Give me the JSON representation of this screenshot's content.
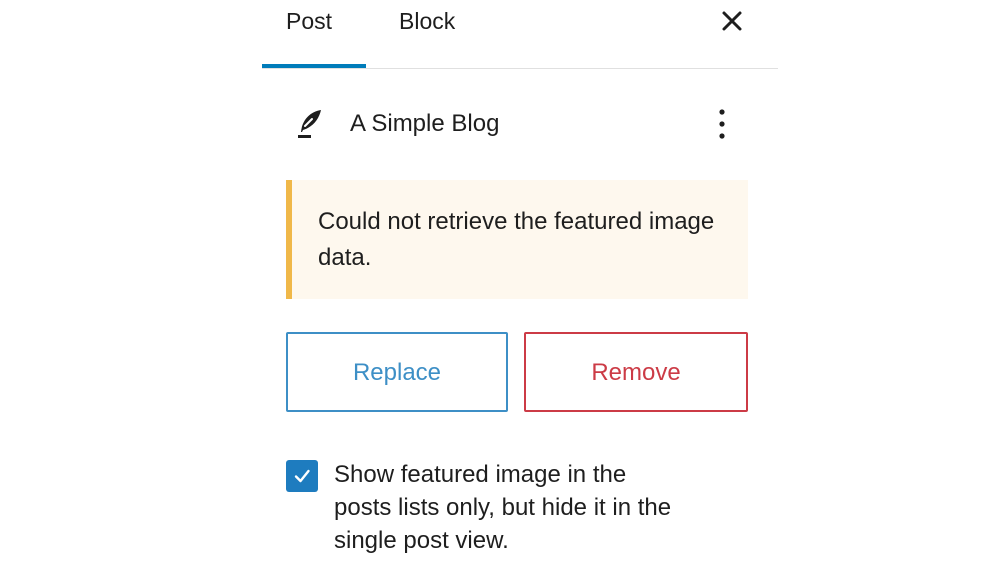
{
  "tabs": [
    {
      "label": "Post",
      "active": true
    },
    {
      "label": "Block",
      "active": false
    }
  ],
  "close_icon": "close-icon",
  "site": {
    "icon": "feather-icon",
    "title": "A Simple Blog",
    "menu_icon": "more-vertical-icon"
  },
  "notice": {
    "text": "Could not retrieve the featured image data.",
    "accent_color": "#f0b849",
    "background": "#fef8ee"
  },
  "actions": {
    "replace_label": "Replace",
    "remove_label": "Remove",
    "replace_color": "#3d8fc6",
    "remove_color": "#cc3b46"
  },
  "option": {
    "checked": true,
    "label": "Show featured image in the posts lists only, but hide it in the single post view."
  },
  "colors": {
    "tab_indicator": "#007cba",
    "checkbox": "#1e7cbf"
  }
}
